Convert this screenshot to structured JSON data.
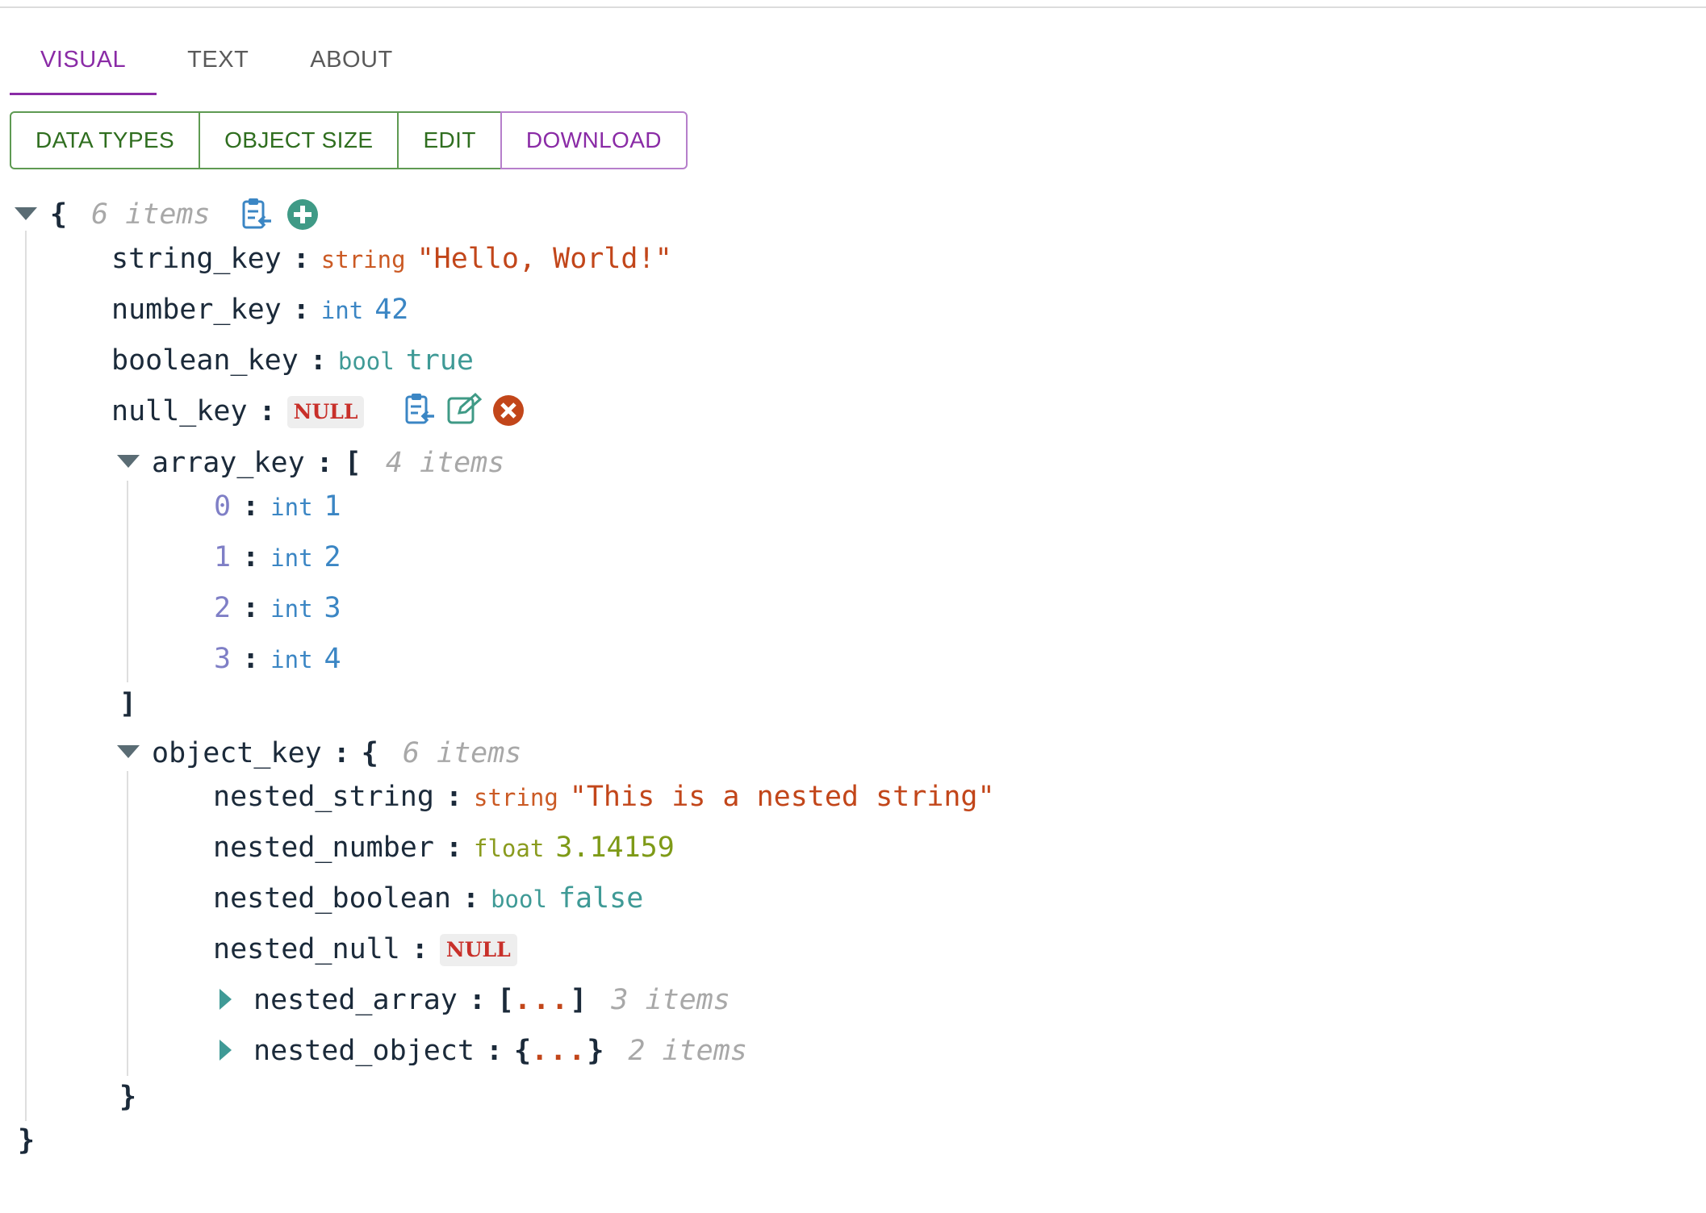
{
  "tabs": [
    {
      "label": "VISUAL",
      "active": true
    },
    {
      "label": "TEXT",
      "active": false
    },
    {
      "label": "ABOUT",
      "active": false
    }
  ],
  "toolbar": {
    "data_types": "DATA TYPES",
    "object_size": "OBJECT SIZE",
    "edit": "EDIT",
    "download": "DOWNLOAD"
  },
  "colors": {
    "accent": "#8a2ba6",
    "toolbar_green": "#2f6e1f",
    "string": "#c2461a",
    "int": "#3b86c4",
    "bool": "#3f9a96",
    "float": "#7e9a17",
    "null": "#c8302a"
  },
  "root": {
    "open": "{",
    "close": "}",
    "meta": "6 items",
    "icons": [
      "copy-icon",
      "add-icon"
    ],
    "entries": {
      "string_key": {
        "key": "string_key",
        "type": "string",
        "value": "\"Hello, World!\""
      },
      "number_key": {
        "key": "number_key",
        "type": "int",
        "value": "42"
      },
      "boolean_key": {
        "key": "boolean_key",
        "type": "bool",
        "value": "true"
      },
      "null_key": {
        "key": "null_key",
        "value": "NULL",
        "icons": [
          "copy-icon",
          "edit-icon",
          "delete-icon"
        ]
      },
      "array_key": {
        "key": "array_key",
        "open": "[",
        "close": "]",
        "meta": "4 items",
        "items": [
          {
            "index": "0",
            "type": "int",
            "value": "1"
          },
          {
            "index": "1",
            "type": "int",
            "value": "2"
          },
          {
            "index": "2",
            "type": "int",
            "value": "3"
          },
          {
            "index": "3",
            "type": "int",
            "value": "4"
          }
        ]
      },
      "object_key": {
        "key": "object_key",
        "open": "{",
        "close": "}",
        "meta": "6 items",
        "nested_string": {
          "key": "nested_string",
          "type": "string",
          "value": "\"This is a nested string\""
        },
        "nested_number": {
          "key": "nested_number",
          "type": "float",
          "value": "3.14159"
        },
        "nested_boolean": {
          "key": "nested_boolean",
          "type": "bool",
          "value": "false"
        },
        "nested_null": {
          "key": "nested_null",
          "value": "NULL"
        },
        "nested_array": {
          "key": "nested_array",
          "open": "[",
          "ellipsis": "...",
          "close": "]",
          "meta": "3 items"
        },
        "nested_object": {
          "key": "nested_object",
          "open": "{",
          "ellipsis": "...",
          "close": "}",
          "meta": "2 items"
        }
      }
    }
  }
}
